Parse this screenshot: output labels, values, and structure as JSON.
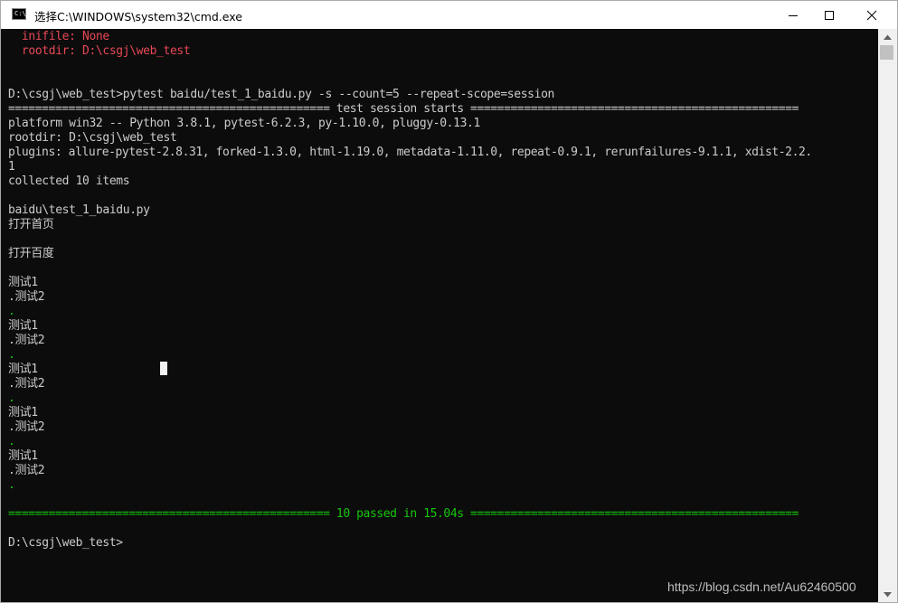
{
  "window": {
    "icon_text": "C:\\",
    "title": "选择C:\\WINDOWS\\system32\\cmd.exe"
  },
  "console": {
    "lines": [
      {
        "text": "  inifile: None",
        "color": "red"
      },
      {
        "text": "  rootdir: D:\\csgj\\web_test",
        "color": "red"
      },
      {
        "text": "",
        "color": "gray"
      },
      {
        "text": "",
        "color": "gray"
      },
      {
        "text": "D:\\csgj\\web_test>pytest baidu/test_1_baidu.py -s --count=5 --repeat-scope=session",
        "color": "gray"
      },
      {
        "text": "================================================ test session starts =================================================",
        "color": "gray"
      },
      {
        "text": "platform win32 -- Python 3.8.1, pytest-6.2.3, py-1.10.0, pluggy-0.13.1",
        "color": "gray"
      },
      {
        "text": "rootdir: D:\\csgj\\web_test",
        "color": "gray"
      },
      {
        "text": "plugins: allure-pytest-2.8.31, forked-1.3.0, html-1.19.0, metadata-1.11.0, repeat-0.9.1, rerunfailures-9.1.1, xdist-2.2.",
        "color": "gray"
      },
      {
        "text": "1",
        "color": "gray"
      },
      {
        "text": "collected 10 items",
        "color": "gray"
      },
      {
        "text": "",
        "color": "gray"
      },
      {
        "text": "baidu\\test_1_baidu.py",
        "color": "gray"
      },
      {
        "text": "打开首页",
        "color": "gray"
      },
      {
        "text": "",
        "color": "gray"
      },
      {
        "text": "打开百度",
        "color": "gray"
      },
      {
        "text": "",
        "color": "gray"
      },
      {
        "text": "测试1",
        "color": "gray"
      },
      {
        "text": ".测试2",
        "color": "gray"
      },
      {
        "text": ".",
        "color": "green"
      },
      {
        "text": "测试1",
        "color": "gray"
      },
      {
        "text": ".测试2",
        "color": "gray"
      },
      {
        "text": ".",
        "color": "green"
      },
      {
        "text": "测试1",
        "color": "gray"
      },
      {
        "text": ".测试2",
        "color": "gray"
      },
      {
        "text": ".",
        "color": "green"
      },
      {
        "text": "测试1",
        "color": "gray"
      },
      {
        "text": ".测试2",
        "color": "gray"
      },
      {
        "text": ".",
        "color": "green"
      },
      {
        "text": "测试1",
        "color": "gray"
      },
      {
        "text": ".测试2",
        "color": "gray"
      },
      {
        "text": ".",
        "color": "green"
      },
      {
        "text": "",
        "color": "gray"
      },
      {
        "text": "================================================ 10 passed in 15.04s =================================================",
        "color": "green"
      },
      {
        "text": "",
        "color": "gray"
      },
      {
        "text": "D:\\csgj\\web_test>",
        "color": "gray"
      }
    ]
  },
  "watermark": "https://blog.csdn.net/Au62460500",
  "colors": {
    "background": "#0c0c0c",
    "text": "#cccccc",
    "red": "#e74856",
    "green": "#16c60c"
  }
}
